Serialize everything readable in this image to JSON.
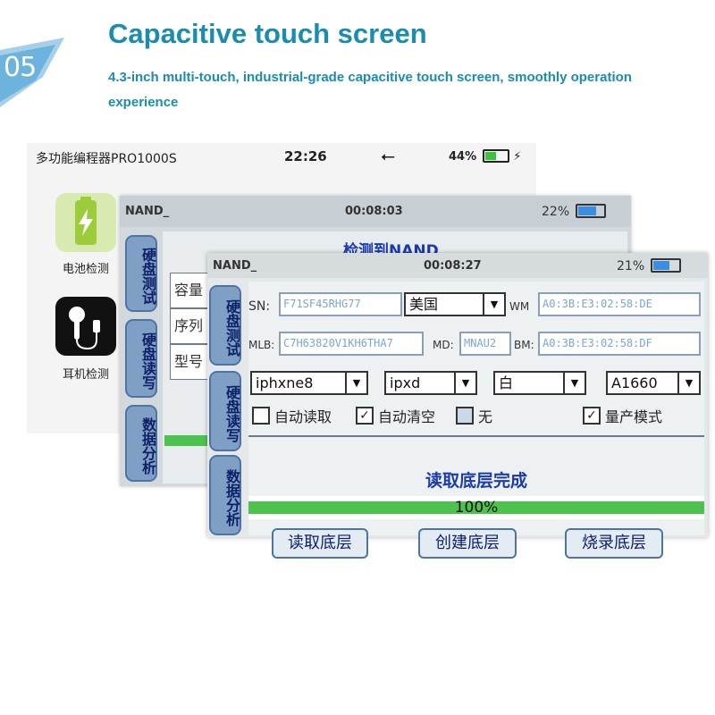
{
  "badge": {
    "number": "05"
  },
  "heading": {
    "title": "Capacitive touch screen",
    "subtitle": "4.3-inch multi-touch, industrial-grade capacitive touch screen, smoothly operation experience"
  },
  "screen1": {
    "title": "多功能编程器PRO1000S",
    "time": "22:26",
    "usb_icon": "usb-icon",
    "battery": "44%",
    "apps": [
      {
        "label": "电池检测",
        "icon": "battery-charge-icon",
        "color": "#cfe39a"
      },
      {
        "label": "耳机检测",
        "icon": "earphone-icon",
        "color": "#111111"
      }
    ]
  },
  "screen2": {
    "mode": "NAND_",
    "time": "00:08:03",
    "battery": "22%",
    "detect_text": "检测到NAND",
    "tabs": [
      "硬盘测试",
      "硬盘读写",
      "数据分析"
    ],
    "labels": [
      "容量",
      "序列",
      "型号"
    ]
  },
  "screen3": {
    "mode": "NAND_",
    "time": "00:08:27",
    "battery": "21%",
    "tabs": [
      "硬盘测试",
      "硬盘读写",
      "数据分析"
    ],
    "fields": {
      "sn_label": "SN:",
      "sn_value": "F71SF45RHG77",
      "region_value": "美国",
      "wm_label": "WM",
      "wm_value": "A0:3B:E3:02:58:DE",
      "mlb_label": "MLB:",
      "mlb_value": "C7H63820V1KH6THA7",
      "md_label": "MD:",
      "md_value": "MNAU2",
      "bm_label": "BM:",
      "bm_value": "A0:3B:E3:02:58:DF"
    },
    "dropdowns": [
      "iphxne8",
      "ipxd",
      "白",
      "A1660"
    ],
    "checkboxes": [
      {
        "label": "自动读取",
        "checked": false
      },
      {
        "label": "自动清空",
        "checked": true
      },
      {
        "label": "无",
        "checked": false
      },
      {
        "label": "量产模式",
        "checked": true
      }
    ],
    "status_text": "读取底层完成",
    "progress": 100,
    "progress_label": "100%",
    "buttons": [
      "读取底层",
      "创建底层",
      "烧录底层"
    ],
    "accent_color": "#1a3ab0",
    "progress_color": "#4dc24d"
  }
}
